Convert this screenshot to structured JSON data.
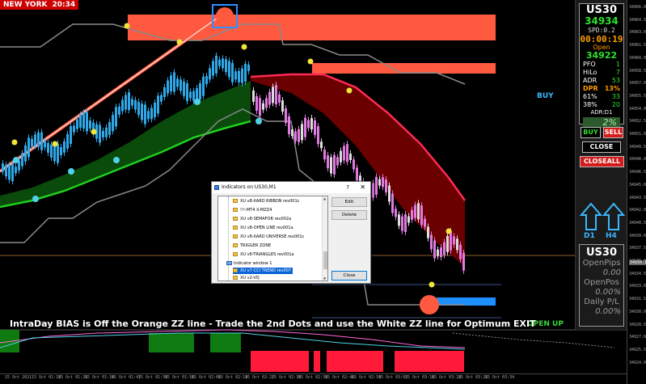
{
  "header": {
    "city": "NEW YORK",
    "time": "20:34"
  },
  "corner_tag": "XU",
  "bias_text": "IntraDay BIAS is Off the Orange ZZ line - Trade the 2nd Dots and use the White ZZ line for Optimum EXIT",
  "signal_buy": "BUY",
  "signal_open_up": "OPEN UP",
  "panel": {
    "symbol": "US30",
    "bid": "34934",
    "spread": "SPD:0.2",
    "countdown": "00:00:19",
    "open_label": "Open",
    "open_value": "34922",
    "rows": [
      {
        "k": "PFO",
        "v": "1"
      },
      {
        "k": "HiLo",
        "v": "7"
      },
      {
        "k": "ADR",
        "v": "53"
      }
    ],
    "dpr": {
      "k": "DPR",
      "v": "13%"
    },
    "pcts": [
      {
        "k": "61%",
        "v": "33"
      },
      {
        "k": "38%",
        "v": "20"
      }
    ],
    "adr_d1": "ADR:D1",
    "pct_box": "2%",
    "buy_btn": "BUY",
    "sell_btn": "SELL",
    "close_btn": "CLOSE",
    "closeall_btn": "CLOSEALL",
    "d1": "D1",
    "h4": "H4",
    "stats_symbol": "US30",
    "open_pips_label": "OpenPips",
    "open_pips_value": "0.00",
    "open_pos_label": "OpenPos",
    "open_pos_value": "0.00%",
    "daily_pl_label": "Daily P/L",
    "daily_pl_value": "0.00%"
  },
  "dialog": {
    "title": "Indicators on US30,M1",
    "help": "?",
    "close_x": "✕",
    "items_top": [
      "XU v8-XARD RIBBON rev001c",
      "!!!-MT4 X-MZZ4",
      "XU v8-SEMAFOR rev002a",
      "XU v8-OPEN LINE rev001a",
      "XU v8-XARD UNIVERSE rev001c",
      "TRIGGER ZONE",
      "XU v8-TRIANGLES rev001a"
    ],
    "window_label": "Indicator window 1",
    "items_bottom": [
      "XU v7-CCI TREND rev007",
      "XU v2-VQ"
    ],
    "edit": "Edit",
    "delete": "Delete",
    "close": "Close"
  },
  "price_axis": [
    "34966.0",
    "34964.5",
    "34963.0",
    "34961.5",
    "34960.0",
    "34958.5",
    "34957.0",
    "34955.5",
    "34954.0",
    "34952.5",
    "34951.0",
    "34949.5",
    "34948.0",
    "34946.5",
    "34945.0",
    "34943.5",
    "34942.0",
    "34940.5",
    "34939.0",
    "34937.5",
    "34936.0",
    "34934.5",
    "34933.0",
    "34931.5",
    "34930.0",
    "34928.5",
    "34927.0",
    "34925.5",
    "34924.0"
  ],
  "price_highlight": "34934.1",
  "time_axis": [
    "15 Oct 2021",
    "15 Oct 01:18",
    "15 Oct 01:26",
    "15 Oct 01:34",
    "15 Oct 01:42",
    "15 Oct 01:50",
    "15 Oct 01:58",
    "15 Oct 02:06",
    "15 Oct 02:14",
    "15 Oct 02:22",
    "15 Oct 02:30",
    "15 Oct 02:38",
    "15 Oct 02:46",
    "15 Oct 02:54",
    "15 Oct 03:02",
    "15 Oct 03:10",
    "15 Oct 03:18",
    "15 Oct 03:26",
    "15 Oct 03:34"
  ],
  "colors": {
    "bull_candle": "#2fa8e8",
    "bear_candle": "#e07ae0",
    "ribbon_up": "#0a4a0a",
    "ribbon_down": "#6a0000",
    "zz_orange": "#ff5a40",
    "white_zz": "#8a8a8a"
  }
}
